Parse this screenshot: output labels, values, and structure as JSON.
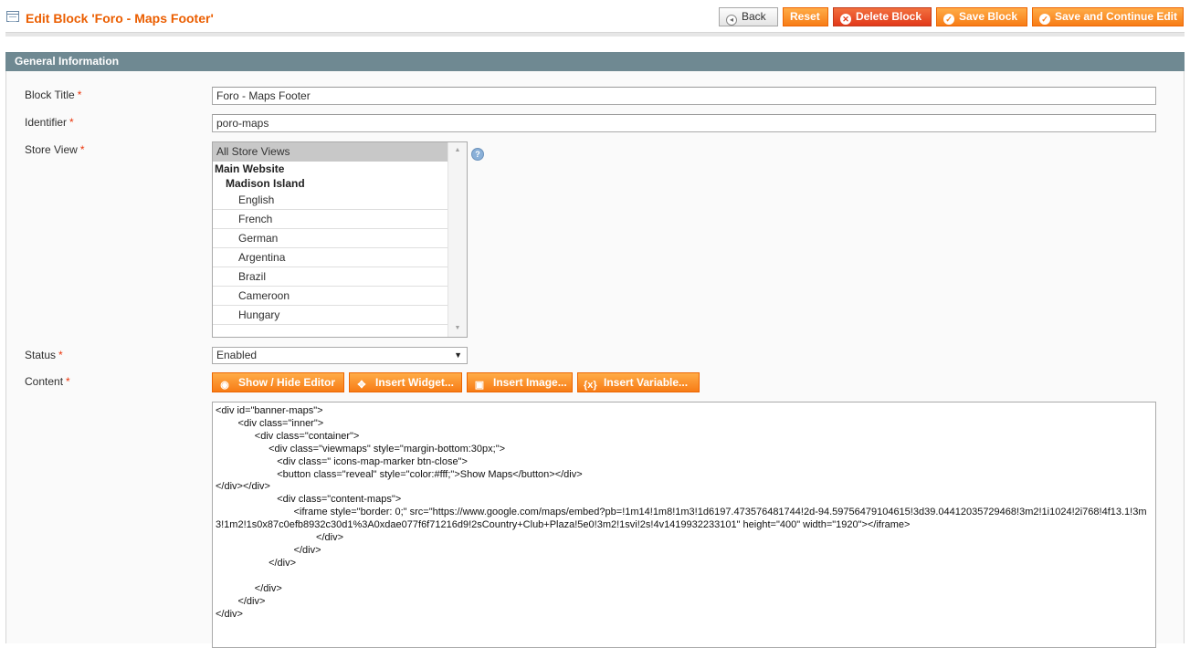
{
  "header": {
    "title": "Edit Block 'Foro - Maps Footer'",
    "buttons": {
      "back": "Back",
      "reset": "Reset",
      "delete": "Delete Block",
      "save": "Save Block",
      "save_continue": "Save and Continue Edit"
    }
  },
  "section": {
    "title": "General Information"
  },
  "form": {
    "block_title": {
      "label": "Block Title",
      "required": "*",
      "value": "Foro - Maps Footer"
    },
    "identifier": {
      "label": "Identifier",
      "required": "*",
      "value": "poro-maps"
    },
    "store_view": {
      "label": "Store View",
      "required": "*",
      "selected": "All Store Views",
      "groups": [
        "Main Website",
        "Madison Island"
      ],
      "options": [
        "English",
        "French",
        "German",
        "Argentina",
        "Brazil",
        "Cameroon",
        "Hungary"
      ]
    },
    "status": {
      "label": "Status",
      "required": "*",
      "value": "Enabled"
    },
    "content": {
      "label": "Content",
      "required": "*",
      "buttons": {
        "show_hide": "Show / Hide Editor",
        "widget": "Insert Widget...",
        "image": "Insert Image...",
        "variable": "Insert Variable..."
      },
      "value": "<div id=\"banner-maps\">\n        <div class=\"inner\">\n              <div class=\"container\">\n                   <div class=\"viewmaps\" style=\"margin-bottom:30px;\">\n                      <div class=\" icons-map-marker btn-close\">\n                      <button class=\"reveal\" style=\"color:#fff;\">Show Maps</button></div>\n</div></div>\n                      <div class=\"content-maps\">\n                            <iframe style=\"border: 0;\" src=\"https://www.google.com/maps/embed?pb=!1m14!1m8!1m3!1d6197.473576481744!2d-94.59756479104615!3d39.04412035729468!3m2!1i1024!2i768!4f13.1!3m3!1m2!1s0x87c0efb8932c30d1%3A0xdae077f6f71216d9!2sCountry+Club+Plaza!5e0!3m2!1svi!2s!4v1419932233101\" height=\"400\" width=\"1920\"></iframe>\n                                    </div>\n                            </div>\n                   </div>\n\n              </div>\n        </div>\n</div>"
    }
  }
}
